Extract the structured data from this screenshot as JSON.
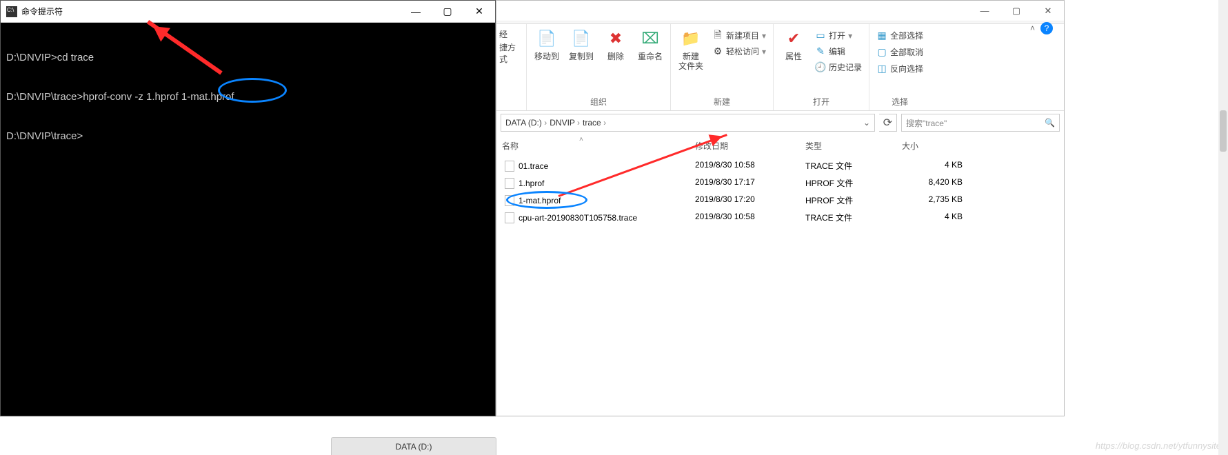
{
  "cmd": {
    "title": "命令提示符",
    "line1": "D:\\DNVIP>cd trace",
    "line2": "D:\\DNVIP\\trace>hprof-conv -z 1.hprof 1-mat.hprof",
    "line3": "D:\\DNVIP\\trace>"
  },
  "explorer": {
    "ribbon_truncated_left1": "经",
    "ribbon_truncated_left2": "捷方式",
    "ribbon": {
      "organize": {
        "move": "移动到",
        "copy": "复制到",
        "delete": "删除",
        "rename": "重命名",
        "label": "组织"
      },
      "new": {
        "folder": "新建\n文件夹",
        "new_item": "新建项目",
        "easy_access": "轻松访问",
        "label": "新建"
      },
      "open": {
        "props": "属性",
        "open": "打开",
        "edit": "编辑",
        "history": "历史记录",
        "label": "打开"
      },
      "select": {
        "all": "全部选择",
        "none": "全部取消",
        "invert": "反向选择",
        "label": "选择"
      }
    },
    "breadcrumbs": [
      "DATA (D:)",
      "DNVIP",
      "trace"
    ],
    "search_placeholder": "搜索\"trace\"",
    "columns": {
      "name": "名称",
      "date": "修改日期",
      "type": "类型",
      "size": "大小"
    },
    "files": [
      {
        "name": "01.trace",
        "date": "2019/8/30 10:58",
        "type": "TRACE 文件",
        "size": "4 KB"
      },
      {
        "name": "1.hprof",
        "date": "2019/8/30 17:17",
        "type": "HPROF 文件",
        "size": "8,420 KB"
      },
      {
        "name": "1-mat.hprof",
        "date": "2019/8/30 17:20",
        "type": "HPROF 文件",
        "size": "2,735 KB"
      },
      {
        "name": "cpu-art-20190830T105758.trace",
        "date": "2019/8/30 10:58",
        "type": "TRACE 文件",
        "size": "4 KB"
      }
    ]
  },
  "bottom_tag": "DATA (D:)",
  "watermark": "https://blog.csdn.net/ytfunnysite"
}
